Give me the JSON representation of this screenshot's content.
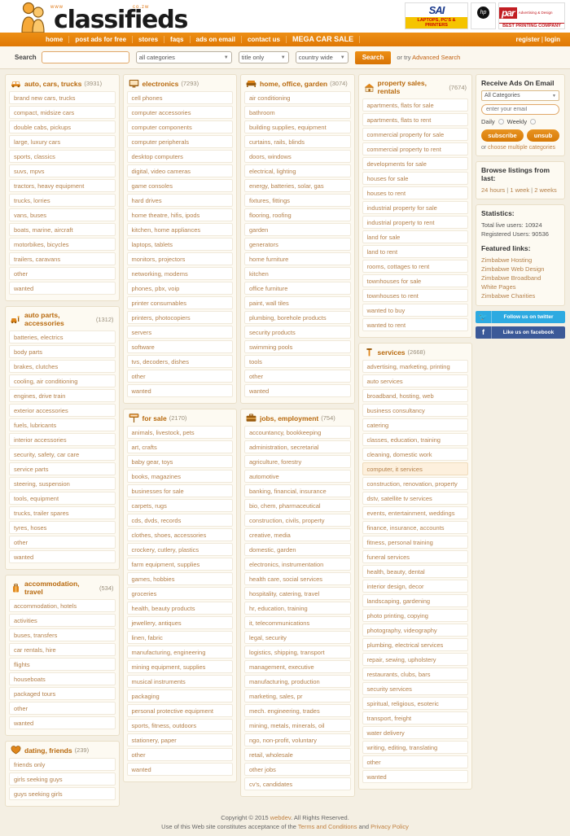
{
  "site": {
    "logo_text": "classifieds",
    "logo_www": "www",
    "logo_domain": "co.zw"
  },
  "banners": [
    {
      "name": "sai-systems",
      "title": "SAI",
      "subtitle": "S Y S T E M S",
      "strip": "LAPTOPS, PC'S & PRINTERS"
    },
    {
      "name": "hp",
      "title": "hp"
    },
    {
      "name": "par-printing",
      "title": "par",
      "subtitle": "Advertising & Design\nRight What To Print & Design",
      "strip": "BEST PRINTING COMPANY"
    }
  ],
  "nav": {
    "items": [
      {
        "label": "home"
      },
      {
        "label": "post ads for free"
      },
      {
        "label": "stores"
      },
      {
        "label": "faqs"
      },
      {
        "label": "ads on email"
      },
      {
        "label": "contact us"
      },
      {
        "label": "MEGA CAR SALE"
      }
    ],
    "register": "register",
    "separator": "|",
    "login": "login"
  },
  "search": {
    "label": "Search",
    "value": "",
    "placeholder": "",
    "category_selected": "all categories",
    "scope_selected": "title only",
    "location_selected": "country wide",
    "button": "Search",
    "tail_prefix": "or try ",
    "advanced_link": "Advanced Search"
  },
  "columns": [
    {
      "panels": [
        {
          "name": "auto-cars-trucks",
          "icon": "car-icon",
          "title": "auto, cars, trucks",
          "count": "(3931)",
          "items": [
            "brand new cars, trucks",
            "compact, midsize cars",
            "double cabs, pickups",
            "large, luxury cars",
            "sports, classics",
            "suvs, mpvs",
            "tractors, heavy equipment",
            "trucks, lorries",
            "vans, buses",
            "boats, marine, aircraft",
            "motorbikes, bicycles",
            "trailers, caravans",
            "other",
            "wanted"
          ]
        },
        {
          "name": "auto-parts-accessories",
          "icon": "car-parts-icon",
          "title": "auto parts, accessories",
          "count": "(1312)",
          "items": [
            "batteries, electrics",
            "body parts",
            "brakes, clutches",
            "cooling, air conditioning",
            "engines, drive train",
            "exterior accessories",
            "fuels, lubricants",
            "interior accessories",
            "security, safety, car care",
            "service parts",
            "steering, suspension",
            "tools, equipment",
            "trucks, trailer spares",
            "tyres, hoses",
            "other",
            "wanted"
          ]
        },
        {
          "name": "accommodation-travel",
          "icon": "luggage-icon",
          "title": "accommodation, travel",
          "count": "(534)",
          "items": [
            "accommodation, hotels",
            "activities",
            "buses, transfers",
            "car rentals, hire",
            "flights",
            "houseboats",
            "packaged tours",
            "other",
            "wanted"
          ]
        },
        {
          "name": "dating-friends",
          "icon": "heart-icon",
          "title": "dating, friends",
          "count": "(239)",
          "items": [
            "friends only",
            "girls seeking guys",
            "guys seeking girls"
          ]
        }
      ]
    },
    {
      "panels": [
        {
          "name": "electronics",
          "icon": "monitor-icon",
          "title": "electronics",
          "count": "(7293)",
          "items": [
            "cell phones",
            "computer accessories",
            "computer components",
            "computer peripherals",
            "desktop computers",
            "digital, video cameras",
            "game consoles",
            "hard drives",
            "home theatre, hifis, ipods",
            "kitchen, home appliances",
            "laptops, tablets",
            "monitors, projectors",
            "networking, modems",
            "phones, pbx, voip",
            "printer consumables",
            "printers, photocopiers",
            "servers",
            "software",
            "tvs, decoders, dishes",
            "other",
            "wanted"
          ]
        },
        {
          "name": "for-sale",
          "icon": "sign-icon",
          "title": "for sale",
          "count": "(2170)",
          "items": [
            "animals, livestock, pets",
            "art, crafts",
            "baby gear, toys",
            "books, magazines",
            "businesses for sale",
            "carpets, rugs",
            "cds, dvds, records",
            "clothes, shoes, accessories",
            "crockery, cutlery, plastics",
            "farm equipment, supplies",
            "games, hobbies",
            "groceries",
            "health, beauty products",
            "jewellery, antiques",
            "linen, fabric",
            "manufacturing, engineering",
            "mining equipment, supplies",
            "musical instruments",
            "packaging",
            "personal protective equipment",
            "sports, fitness, outdoors",
            "stationery, paper",
            "other",
            "wanted"
          ]
        }
      ]
    },
    {
      "panels": [
        {
          "name": "home-office-garden",
          "icon": "sofa-icon",
          "title": "home, office, garden",
          "count": "(3074)",
          "items": [
            "air conditioning",
            "bathroom",
            "building supplies, equipment",
            "curtains, rails, blinds",
            "doors, windows",
            "electrical, lighting",
            "energy, batteries, solar, gas",
            "fixtures, fittings",
            "flooring, roofing",
            "garden",
            "generators",
            "home furniture",
            "kitchen",
            "office furniture",
            "paint, wall tiles",
            "plumbing, borehole products",
            "security products",
            "swimming pools",
            "tools",
            "other",
            "wanted"
          ]
        },
        {
          "name": "jobs-employment",
          "icon": "briefcase-icon",
          "title": "jobs, employment",
          "count": "(754)",
          "items": [
            "accountancy, bookkeeping",
            "administration, secretarial",
            "agriculture, forestry",
            "automotive",
            "banking, financial, insurance",
            "bio, chem, pharmaceutical",
            "construction, civils, property",
            "creative, media",
            "domestic, garden",
            "electronics, instrumentation",
            "health care, social services",
            "hospitality, catering, travel",
            "hr, education, training",
            "it, telecommunications",
            "legal, security",
            "logistics, shipping, transport",
            "management, executive",
            "manufacturing, production",
            "marketing, sales, pr",
            "mech. engineering, trades",
            "mining, metals, minerals, oil",
            "ngo, non-profit, voluntary",
            "retail, wholesale",
            "other jobs",
            "cv's, candidates"
          ]
        }
      ]
    },
    {
      "panels": [
        {
          "name": "property-sales-rentals",
          "icon": "house-icon",
          "title": "property sales, rentals",
          "count": "(7674)",
          "items": [
            "apartments, flats for sale",
            "apartments, flats to rent",
            "commercial property for sale",
            "commercial property to rent",
            "developments for sale",
            "houses for sale",
            "houses to rent",
            "industrial property for sale",
            "industrial property to rent",
            "land for sale",
            "land to rent",
            "rooms, cottages to rent",
            "townhouses for sale",
            "townhouses to rent",
            "wanted to buy",
            "wanted to rent"
          ]
        },
        {
          "name": "services",
          "icon": "tools-icon",
          "title": "services",
          "count": "(2668)",
          "items": [
            "advertising, marketing, printing",
            "auto services",
            "broadband, hosting, web",
            "business consultancy",
            "catering",
            "classes, education, training",
            "cleaning, domestic work",
            "computer, it services",
            "construction, renovation, property",
            "dstv, satellite tv services",
            "events, entertainment, weddings",
            "finance, insurance, accounts",
            "fitness, personal training",
            "funeral services",
            "health, beauty, dental",
            "interior design, decor",
            "landscaping, gardening",
            "photo printing, copying",
            "photography, videography",
            "plumbing, electrical services",
            "repair, sewing, upholstery",
            "restaurants, clubs, bars",
            "security services",
            "spiritual, religious, esoteric",
            "transport, freight",
            "water delivery",
            "writing, editing, translating",
            "other",
            "wanted"
          ],
          "highlighted_item": "computer, it services"
        }
      ]
    }
  ],
  "sidebar": {
    "email_box": {
      "title": "Receive Ads On Email",
      "category_selected": "All Categories",
      "email_value": "",
      "email_placeholder": "enter your email",
      "daily_label": "Daily",
      "weekly_label": "Weekly",
      "subscribe_label": "subscribe",
      "unsub_label": "unsub",
      "footer_prefix": "or ",
      "footer_link": "choose multiple categories"
    },
    "browse_box": {
      "title": "Browse listings from last:",
      "links": [
        "24 hours",
        "1 week",
        "2 weeks"
      ],
      "separator": " | "
    },
    "statistics": {
      "title": "Statistics:",
      "lines": [
        "Total live users: 10924",
        "Registered Users: 90536"
      ]
    },
    "featured": {
      "title": "Featured links:",
      "links": [
        "Zimbabwe Hosting",
        "Zimbabwe Web Design",
        "Zimbabwe Broadband",
        "White Pages",
        "Zimbabwe Charities"
      ]
    },
    "social": [
      {
        "name": "twitter",
        "glyph": "ᴠ",
        "label": "Follow us on twitter"
      },
      {
        "name": "facebook",
        "glyph": "f",
        "label": "Like us on facebook"
      }
    ]
  },
  "footer": {
    "line1_pre": "Copyright © 2015 ",
    "line1_link": "webdev",
    "line1_post": ". All Rights Reserved.",
    "line2_pre": "Use of this Web site constitutes acceptance of the ",
    "line2_link1": "Terms and Conditions",
    "line2_mid": " and ",
    "line2_link2": "Privacy Policy"
  },
  "colors": {
    "accent": "#e07c0a",
    "link": "#b5814a",
    "panel_bg": "#fdfaf2",
    "page_bg": "#f4efe3"
  }
}
